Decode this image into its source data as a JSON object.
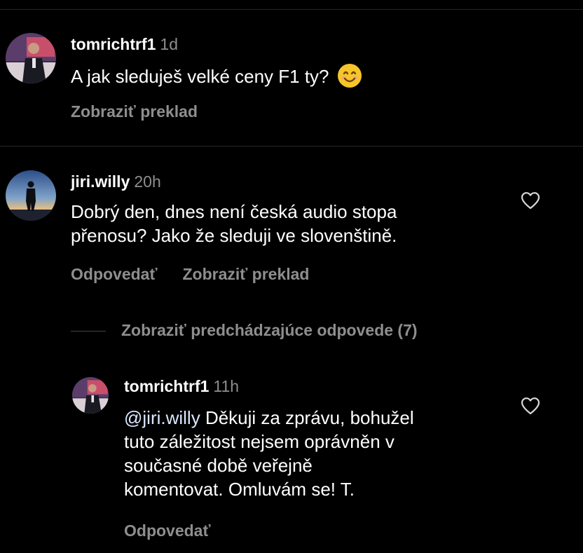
{
  "colors": {
    "background": "#000000",
    "text": "#ffffff",
    "secondary": "#8e8e8e",
    "divider": "#262626"
  },
  "comments": [
    {
      "username": "tomrichtrf1",
      "time": "1d",
      "text": "A jak sleduješ velké ceny F1 ty?",
      "emoji": "smiling-face-emoji",
      "actions": [
        "Zobraziť preklad"
      ]
    },
    {
      "username": "jiri.willy",
      "time": "20h",
      "text_lines": [
        "Dobrý den, dnes není česká audio stopa",
        "přenosu? Jako že sleduji ve slovenštině."
      ],
      "actions": [
        "Odpovedať",
        "Zobraziť preklad"
      ]
    }
  ],
  "view_previous_replies": "Zobraziť predchádzajúce odpovede (7)",
  "reply": {
    "username": "tomrichtrf1",
    "time": "11h",
    "mention": "@jiri.willy",
    "text_first": " Děkuji za zprávu, bohužel",
    "text_lines": [
      "tuto záležitost nejsem oprávněn v",
      "současné době veřejně",
      "komentovat. Omluvám se! T."
    ],
    "actions": [
      "Odpovedať"
    ]
  },
  "icons": [
    "heart-icon",
    "avatar-tomrichtrf1",
    "avatar-jiri-willy"
  ]
}
